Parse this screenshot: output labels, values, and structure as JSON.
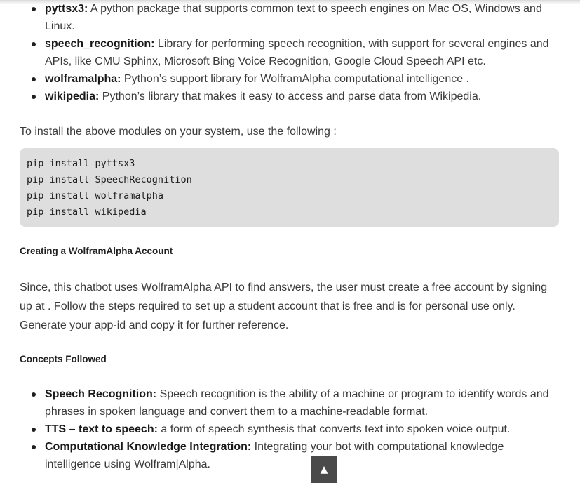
{
  "modules_list": [
    {
      "name": "pyttsx3:",
      "desc": " A python package that supports common text to speech engines on Mac OS, Windows and Linux."
    },
    {
      "name": "speech_recognition:",
      "desc": " Library for performing speech recognition, with support for several engines and APIs, like CMU Sphinx, Microsoft Bing Voice Recognition, Google Cloud Speech API etc."
    },
    {
      "name": "wolframalpha:",
      "desc": " Python’s support library for WolframAlpha computational intelligence ."
    },
    {
      "name": "wikipedia:",
      "desc": " Python’s library that makes it easy to access and parse data from Wikipedia."
    }
  ],
  "install_intro": "To install the above modules on your system, use the following :",
  "code_lines": [
    "pip install pyttsx3",
    "pip install SpeechRecognition",
    "pip install wolframalpha",
    "pip install wikipedia"
  ],
  "account_heading": "Creating a WolframAlpha Account",
  "account_text": "Since, this chatbot uses WolframAlpha API to find answers, the user must create a free account by signing up at . Follow the steps required to set up a student account that is free and is for personal use only. Generate your app-id and copy it for further reference.",
  "concepts_heading": "Concepts Followed",
  "concepts_list": [
    {
      "name": "Speech Recognition:",
      "desc": " Speech recognition is the ability of a machine or program to identify words and phrases in spoken language and convert them to a machine-readable format."
    },
    {
      "name": "TTS – text to speech:",
      "desc": " a form of speech synthesis that converts text into spoken voice output."
    },
    {
      "name": "Computational Knowledge Integration:",
      "desc": " Integrating your bot with computational knowledge intelligence using Wolfram|Alpha."
    }
  ],
  "scroll_top_icon": "▲"
}
